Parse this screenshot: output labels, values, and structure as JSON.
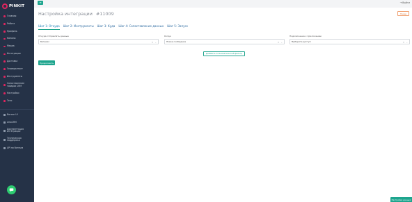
{
  "logo": {
    "text": "PINKIT"
  },
  "sidebar": {
    "items": [
      {
        "label": "Главная",
        "icon": "home-icon"
      },
      {
        "label": "Работа",
        "icon": "work-icon"
      },
      {
        "label": "Профиль",
        "icon": "profile-icon"
      },
      {
        "label": "Каналы",
        "icon": "channels-icon"
      },
      {
        "label": "Медиа",
        "icon": "media-icon"
      },
      {
        "label": "Интеграции",
        "icon": "integrations-icon"
      },
      {
        "label": "Доставка",
        "icon": "delivery-icon"
      },
      {
        "label": "Геомаркетинг",
        "icon": "geo-icon"
      },
      {
        "label": "Инструменты",
        "icon": "tools-icon"
      },
      {
        "label": "Сопоставление товаров CRM",
        "icon": "crm-icon"
      },
      {
        "label": "Настройки",
        "icon": "settings-icon"
      },
      {
        "label": "Теги",
        "icon": "tags-icon"
      }
    ],
    "secondary": [
      {
        "label": "Ватсап UI",
        "icon": "whatsapp-icon"
      },
      {
        "label": "amoCRM",
        "icon": "crm-box-icon"
      },
      {
        "label": "Документация интеграции",
        "icon": "docs-icon"
      },
      {
        "label": "Техническая поддержка",
        "icon": "support-icon"
      },
      {
        "label": "API по ботным",
        "icon": "api-icon"
      }
    ]
  },
  "topbar": {
    "menu_symbol": "≡",
    "logout_label": "Выйти"
  },
  "header": {
    "title": "Настройка интеграции",
    "id": "#11009",
    "back_label": "Назад"
  },
  "tabs": [
    {
      "label": "Шаг 1: Откуда",
      "active": true
    },
    {
      "label": "Шаг 2: Инструменты",
      "active": false
    },
    {
      "label": "Шаг 3: Куда",
      "active": false
    },
    {
      "label": "Шаг 4: Сопоставление данных",
      "active": false
    },
    {
      "label": "Шаг 5: Запуск",
      "active": false
    }
  ],
  "form": {
    "source": {
      "label": "Откуда отправлять данные",
      "value": "Битрикс"
    },
    "event": {
      "label": "Когда",
      "value": "Новое сообщение"
    },
    "connection": {
      "label": "Подключение к приложению",
      "value": "Выберите доступ"
    },
    "add_variable_label": "Добавить пользовательский фильтр",
    "continue_label": "Продолжить"
  },
  "footer": {
    "settings_label": "Настройки данных"
  },
  "colors": {
    "accent": "#1ea58e",
    "brand": "#e0245e",
    "sidebar": "#253247",
    "back": "#e07a3c"
  }
}
